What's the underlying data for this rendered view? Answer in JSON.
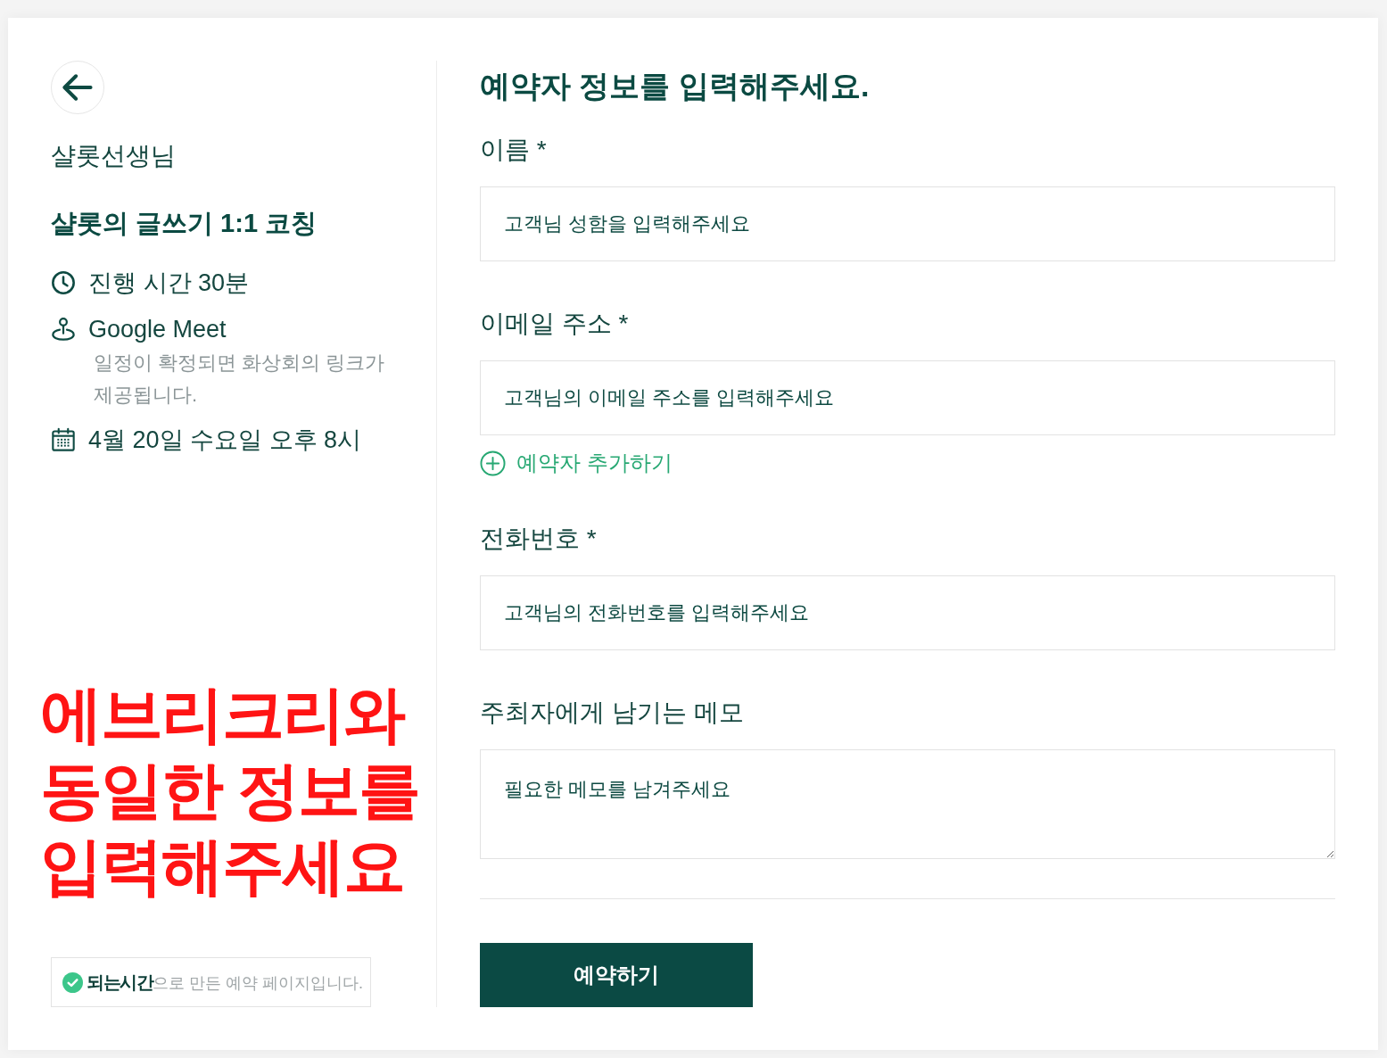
{
  "sidebar": {
    "host": "샬롯선생님",
    "event_title": "샬롯의 글쓰기 1:1 코칭",
    "details": [
      {
        "kind": "duration",
        "text": "진행 시간 30분"
      },
      {
        "kind": "location",
        "text": "Google Meet",
        "note": "일정이 확정되면 화상회의 링크가 제공됩니다."
      },
      {
        "kind": "date",
        "text": "4월 20일 수요일 오후 8시"
      }
    ],
    "annotation": {
      "lines": [
        "에브리크리와",
        "동일한 정보를",
        "입력해주세요"
      ]
    },
    "footer": {
      "text": "**되는시간**으로 만든 예약 페이지입니다."
    }
  },
  "form": {
    "title": "예약자 정보를 입력해주세요.",
    "items": [
      {
        "kind": "input",
        "label": "이름 *",
        "placeholder": "고객님 성함을 입력해주세요"
      },
      {
        "kind": "input",
        "label": "이메일 주소 *",
        "placeholder": "고객님의 이메일 주소를 입력해주세요"
      },
      {
        "kind": "add-link",
        "label": "예약자 추가하기"
      },
      {
        "kind": "input",
        "label": "전화번호 *",
        "placeholder": "고객님의 전화번호를 입력해주세요"
      },
      {
        "kind": "textarea",
        "label": "주최자에게 남기는 메모",
        "placeholder": "필요한 메모를 남겨주세요"
      }
    ],
    "submit": "예약하기"
  }
}
